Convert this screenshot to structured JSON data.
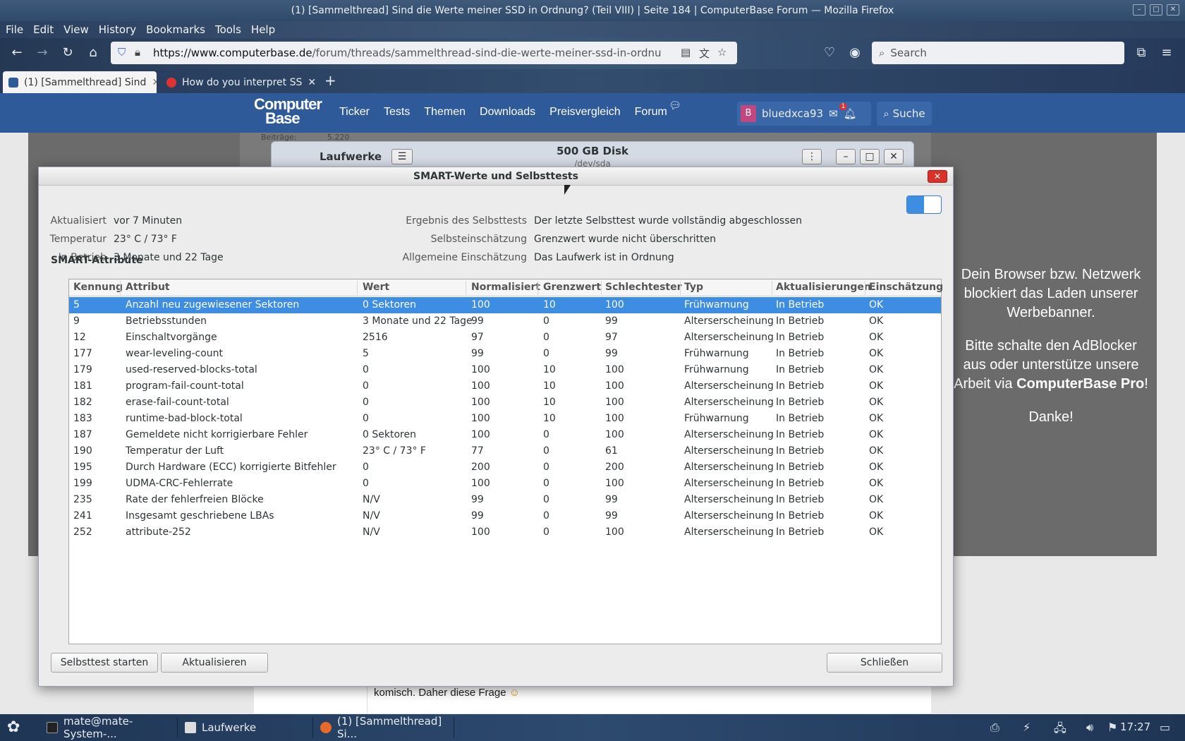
{
  "window_title": "(1) [Sammelthread] Sind die Werte meiner SSD in Ordnung? (Teil VIII) | Seite 184 | ComputerBase Forum — Mozilla Firefox",
  "menu": [
    "File",
    "Edit",
    "View",
    "History",
    "Bookmarks",
    "Tools",
    "Help"
  ],
  "url": {
    "domain": "https://www.computerbase.de",
    "path": "/forum/threads/sammelthread-sind-die-werte-meiner-ssd-in-ordnung-teil-v"
  },
  "search_placeholder": "Search",
  "tabs": [
    {
      "title": "(1) [Sammelthread] Sind",
      "active": true
    },
    {
      "title": "How do you interpret SS",
      "active": false
    }
  ],
  "site": {
    "logo_line1": "Computer",
    "logo_line2": "Base",
    "nav": [
      "Ticker",
      "Tests",
      "Themen",
      "Downloads",
      "Preisvergleich",
      "Forum"
    ],
    "user_initial": "B",
    "username": "bluedxca93",
    "notif_count": "1",
    "search_label": "Suche"
  },
  "behind": {
    "beitraege_label": "Beiträge:",
    "beitraege_value": "5.220",
    "laufwerke_title": "Laufwerke",
    "disk_title": "500 GB Disk",
    "disk_dev": "/dev/sda"
  },
  "ad": {
    "line1": "Dein Browser bzw. Netzwerk blockiert das Laden unserer Werbebanner.",
    "line2_pre": "Bitte schalte den AdBlocker aus oder unterstütze unsere Arbeit via ",
    "line2_bold": "ComputerBase Pro",
    "line2_post": "!",
    "line3": "Danke!"
  },
  "forum_text": "komisch. Daher diese Frage",
  "dialog": {
    "title": "SMART-Werte und Selbsttests",
    "left": [
      {
        "label": "Aktualisiert",
        "value": "vor 7 Minuten"
      },
      {
        "label": "Temperatur",
        "value": "23° C / 73° F"
      },
      {
        "label": "In Betrieb",
        "value": "3 Monate und 22 Tage"
      }
    ],
    "right": [
      {
        "label": "Ergebnis des Selbsttests",
        "value": "Der letzte Selbsttest wurde vollständig abgeschlossen"
      },
      {
        "label": "Selbsteinschätzung",
        "value": "Grenzwert wurde nicht überschritten"
      },
      {
        "label": "Allgemeine Einschätzung",
        "value": "Das Laufwerk ist in Ordnung"
      }
    ],
    "section_title": "SMART-Attribute",
    "columns": [
      "Kennung",
      "Attribut",
      "Wert",
      "Normalisiert",
      "Grenzwert",
      "Schlechtester",
      "Typ",
      "Aktualisierungen",
      "Einschätzung"
    ],
    "rows": [
      [
        "5",
        "Anzahl neu zugewiesener Sektoren",
        "0 Sektoren",
        "100",
        "10",
        "100",
        "Frühwarnung",
        "In Betrieb",
        "OK"
      ],
      [
        "9",
        "Betriebsstunden",
        "3 Monate und 22 Tage",
        "99",
        "0",
        "99",
        "Alterserscheinung",
        "In Betrieb",
        "OK"
      ],
      [
        "12",
        "Einschaltvorgänge",
        "2516",
        "97",
        "0",
        "97",
        "Alterserscheinung",
        "In Betrieb",
        "OK"
      ],
      [
        "177",
        "wear-leveling-count",
        "5",
        "99",
        "0",
        "99",
        "Frühwarnung",
        "In Betrieb",
        "OK"
      ],
      [
        "179",
        "used-reserved-blocks-total",
        "0",
        "100",
        "10",
        "100",
        "Frühwarnung",
        "In Betrieb",
        "OK"
      ],
      [
        "181",
        "program-fail-count-total",
        "0",
        "100",
        "10",
        "100",
        "Alterserscheinung",
        "In Betrieb",
        "OK"
      ],
      [
        "182",
        "erase-fail-count-total",
        "0",
        "100",
        "10",
        "100",
        "Alterserscheinung",
        "In Betrieb",
        "OK"
      ],
      [
        "183",
        "runtime-bad-block-total",
        "0",
        "100",
        "10",
        "100",
        "Frühwarnung",
        "In Betrieb",
        "OK"
      ],
      [
        "187",
        "Gemeldete nicht korrigierbare Fehler",
        "0 Sektoren",
        "100",
        "0",
        "100",
        "Alterserscheinung",
        "In Betrieb",
        "OK"
      ],
      [
        "190",
        "Temperatur der Luft",
        "23° C / 73° F",
        "77",
        "0",
        "61",
        "Alterserscheinung",
        "In Betrieb",
        "OK"
      ],
      [
        "195",
        "Durch Hardware (ECC) korrigierte Bitfehler",
        "0",
        "200",
        "0",
        "200",
        "Alterserscheinung",
        "In Betrieb",
        "OK"
      ],
      [
        "199",
        "UDMA-CRC-Fehlerrate",
        "0",
        "100",
        "0",
        "100",
        "Alterserscheinung",
        "In Betrieb",
        "OK"
      ],
      [
        "235",
        "Rate der fehlerfreien Blöcke",
        "N/V",
        "99",
        "0",
        "99",
        "Alterserscheinung",
        "In Betrieb",
        "OK"
      ],
      [
        "241",
        "Insgesamt geschriebene LBAs",
        "N/V",
        "99",
        "0",
        "99",
        "Alterserscheinung",
        "In Betrieb",
        "OK"
      ],
      [
        "252",
        "attribute-252",
        "N/V",
        "100",
        "0",
        "100",
        "Alterserscheinung",
        "In Betrieb",
        "OK"
      ]
    ],
    "selected_row": 0,
    "buttons": {
      "selftest": "Selbsttest starten",
      "refresh": "Aktualisieren",
      "close": "Schließen"
    }
  },
  "taskbar": {
    "items": [
      "mate@mate-System-...",
      "Laufwerke",
      "(1) [Sammelthread] Si..."
    ],
    "clock": "17:27"
  },
  "colors": {
    "selection": "#3d8de3",
    "site_header": "#2e5a9a",
    "close_button": "#d9322a"
  }
}
